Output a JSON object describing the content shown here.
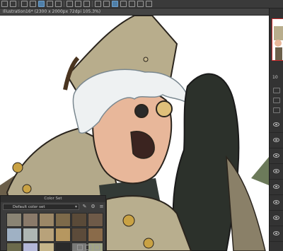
{
  "app": {
    "doc_title": "Illustration16* (2300 x 2000px 72dpi 105.3%)"
  },
  "toolbar": {
    "icons": [
      "undo-icon",
      "redo-icon",
      "transform-icon",
      "select-icon",
      "fill-icon",
      "brush-icon",
      "eraser-icon",
      "move-icon",
      "rotate-icon",
      "redo2-icon",
      "pen-icon",
      "gradient-icon",
      "active-brush-icon",
      "layer-icon",
      "ruler-icon",
      "text-icon",
      "hand-icon"
    ]
  },
  "right_panel": {
    "zoom_label": "10"
  },
  "color_set": {
    "title": "Color Set",
    "set_name": "Default color set",
    "swatches": [
      "#8a8474",
      "#8a7a6a",
      "#9b8767",
      "#7d6a4a",
      "#5a4a38",
      "#6e5a48",
      "#9fb1c4",
      "#aeb6b3",
      "#b8a27a",
      "#b69760",
      "#5c4b3a",
      "#8a6b4a",
      "#6b6a4c",
      "#b3b7d8",
      "#c5b58a",
      "#2a2a2a",
      "#7a7a78",
      "#a0a486"
    ]
  }
}
